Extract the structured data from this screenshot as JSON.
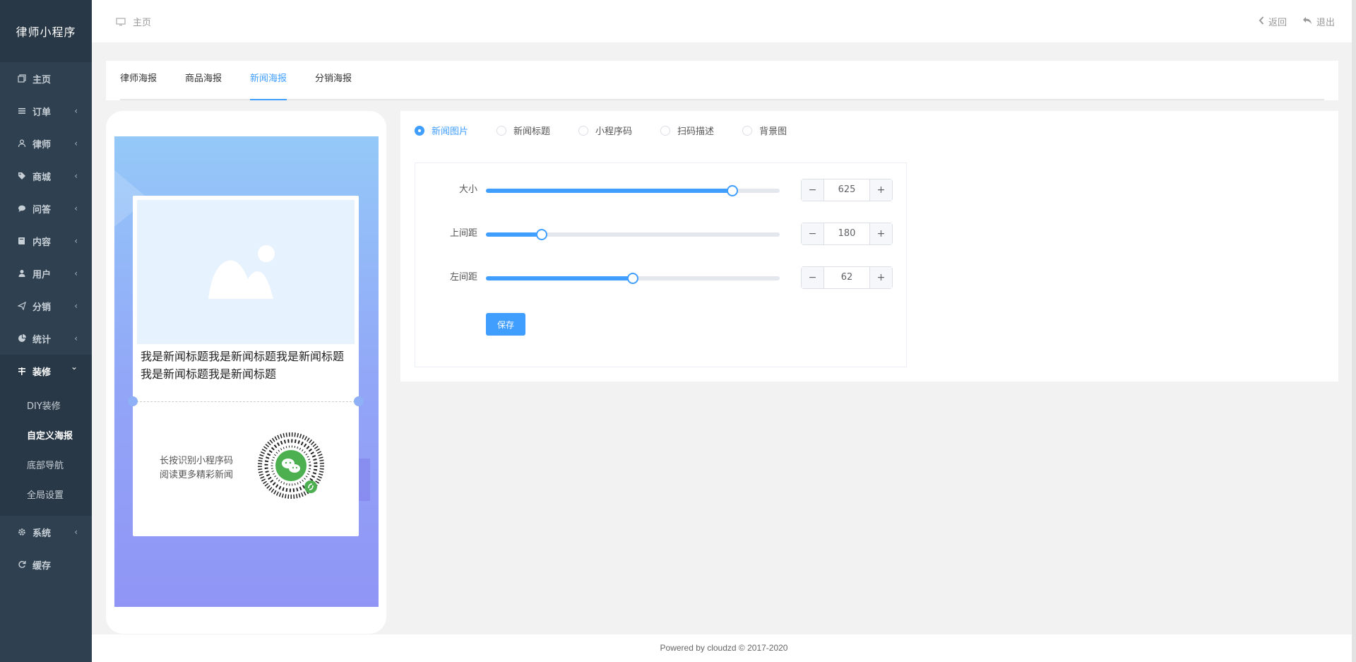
{
  "app": {
    "title": "律师小程序"
  },
  "sidebar": {
    "items": [
      {
        "label": "主页",
        "icon": "copy-icon",
        "has_chevron": false
      },
      {
        "label": "订单",
        "icon": "list-icon",
        "has_chevron": true
      },
      {
        "label": "律师",
        "icon": "user-outline-icon",
        "has_chevron": true
      },
      {
        "label": "商城",
        "icon": "tags-icon",
        "has_chevron": true
      },
      {
        "label": "问答",
        "icon": "comment-icon",
        "has_chevron": true
      },
      {
        "label": "内容",
        "icon": "book-icon",
        "has_chevron": true
      },
      {
        "label": "用户",
        "icon": "user-icon",
        "has_chevron": true
      },
      {
        "label": "分销",
        "icon": "send-icon",
        "has_chevron": true
      },
      {
        "label": "统计",
        "icon": "pie-chart-icon",
        "has_chevron": true
      },
      {
        "label": "装修",
        "icon": "decorate-icon",
        "expanded": true
      },
      {
        "label": "系统",
        "icon": "gear-icon",
        "has_chevron": true
      },
      {
        "label": "缓存",
        "icon": "refresh-icon",
        "has_chevron": false
      }
    ],
    "chevron": "‹",
    "chevron_down": "⌄",
    "submenu": [
      {
        "label": "DIY装修"
      },
      {
        "label": "自定义海报",
        "active": true
      },
      {
        "label": "底部导航"
      },
      {
        "label": "全局设置"
      }
    ]
  },
  "topbar": {
    "breadcrumb": "主页",
    "back": "返回",
    "logout": "退出"
  },
  "tabs": [
    "律师海报",
    "商品海报",
    "新闻海报",
    "分销海报"
  ],
  "active_tab": "新闻海报",
  "poster": {
    "news_title": "我是新闻标题我是新闻标题我是新闻标题我是新闻标题我是新闻标题",
    "scan_line1": "长按识别小程序码",
    "scan_line2": "阅读更多精彩新闻"
  },
  "radios": {
    "options": [
      "新闻图片",
      "新闻标题",
      "小程序码",
      "扫码描述",
      "背景图"
    ],
    "selected": "新闻图片"
  },
  "settings": {
    "size": {
      "label": "大小",
      "value": "625",
      "slider_fraction": 0.84
    },
    "top": {
      "label": "上间距",
      "value": "180",
      "slider_fraction": 0.19
    },
    "left": {
      "label": "左间距",
      "value": "62",
      "slider_fraction": 0.5
    },
    "minus": "−",
    "plus": "+",
    "save_label": "保存"
  },
  "footer": {
    "text": "Powered by cloudzd © 2017-2020"
  },
  "colors": {
    "accent": "#409eff",
    "sidebar": "#2f4050"
  }
}
